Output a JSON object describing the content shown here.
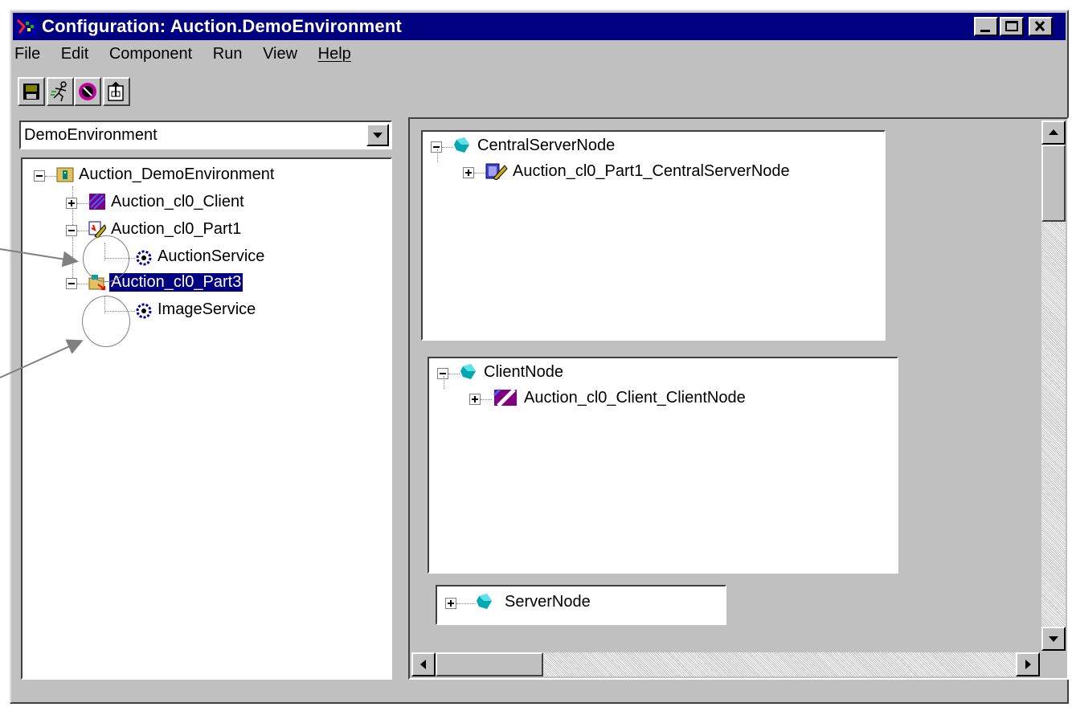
{
  "window": {
    "title": "Configuration: Auction.DemoEnvironment"
  },
  "menu": [
    "File",
    "Edit",
    "Component",
    "Run",
    "View",
    "Help"
  ],
  "toolbar": {
    "icons": [
      "save-icon",
      "run-icon",
      "stop-icon",
      "export-icon"
    ]
  },
  "environment_select": {
    "value": "DemoEnvironment"
  },
  "tree": {
    "root": "Auction_DemoEnvironment",
    "client": "Auction_cl0_Client",
    "part1": "Auction_cl0_Part1",
    "auction_service": "AuctionService",
    "part3": "Auction_cl0_Part3",
    "image_service": "ImageService"
  },
  "nodes": {
    "central": {
      "name": "CentralServerNode",
      "child": "Auction_cl0_Part1_CentralServerNode"
    },
    "client": {
      "name": "ClientNode",
      "child": "Auction_cl0_Client_ClientNode"
    },
    "server": {
      "name": "ServerNode"
    }
  },
  "colors": {
    "titlebar": "#000080",
    "face": "#c0c0c0",
    "selection": "#000080",
    "node_icon": "#00a0a8"
  }
}
